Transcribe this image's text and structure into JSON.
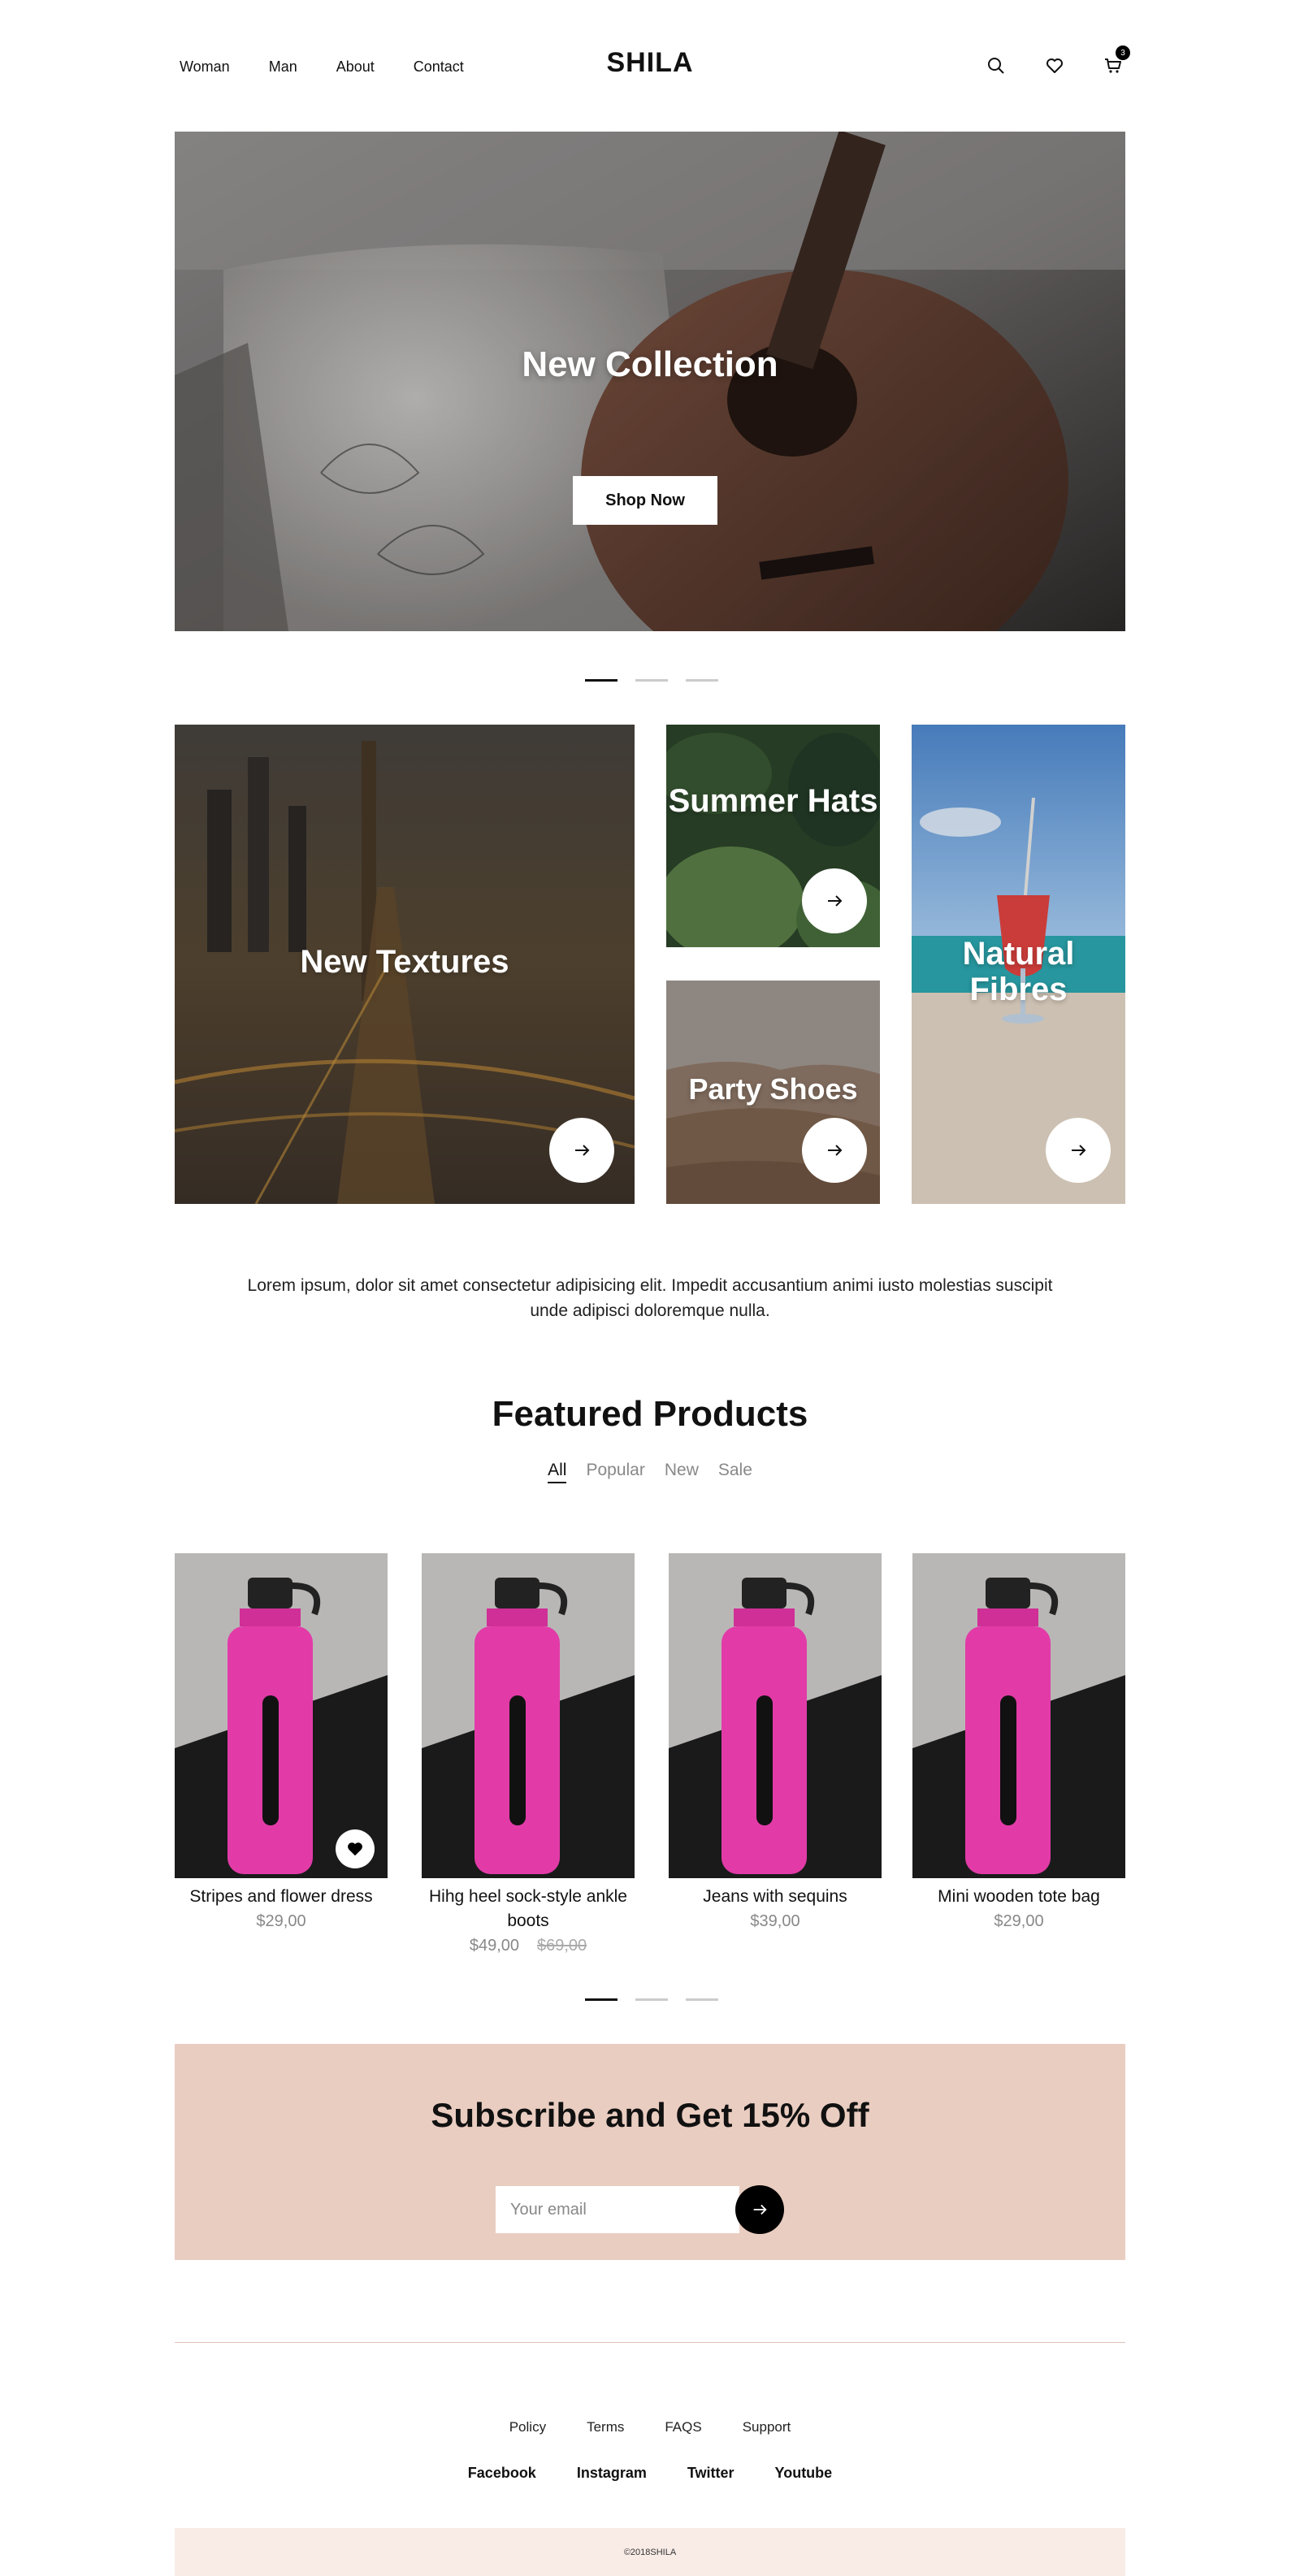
{
  "header": {
    "nav": [
      "Woman",
      "Man",
      "About",
      "Contact"
    ],
    "logo": "SHILA",
    "cart_count": "3",
    "icons": [
      "search-icon",
      "heart-icon",
      "cart-icon"
    ]
  },
  "hero": {
    "title": "New Collection",
    "button": "Shop Now",
    "active_slide": 1,
    "slides": 3
  },
  "categories": [
    {
      "label": "New Textures"
    },
    {
      "label": "Summer Hats"
    },
    {
      "label": "Party Shoes"
    },
    {
      "label": "Natural Fibres"
    }
  ],
  "intro": "Lorem ipsum, dolor sit amet consectetur adipisicing elit. Impedit accusantium animi iusto molestias suscipit unde adipisci doloremque nulla.",
  "featured": {
    "title": "Featured Products",
    "filters": [
      "All",
      "Popular",
      "New",
      "Sale"
    ],
    "active_filter": "All",
    "products": [
      {
        "name": "Stripes and flower dress",
        "price": "$29,00",
        "old_price": ""
      },
      {
        "name": "Hihg heel sock-style ankle boots",
        "price": "$49,00",
        "old_price": "$69,00"
      },
      {
        "name": "Jeans with sequins",
        "price": "$39,00",
        "old_price": ""
      },
      {
        "name": "Mini wooden tote bag",
        "price": "$29,00",
        "old_price": ""
      }
    ]
  },
  "subscribe": {
    "title": "Subscribe and Get 15% Off",
    "placeholder": "Your email"
  },
  "footer": {
    "links": [
      "Policy",
      "Terms",
      "FAQS",
      "Support"
    ],
    "social": [
      "Facebook",
      "Instagram",
      "Twitter",
      "Youtube"
    ],
    "copyright": "©2018SHILA"
  },
  "colors": {
    "accent_pink": "#eacdc1",
    "footer_bg": "#f9ece7",
    "text": "#111111",
    "muted": "#888888"
  }
}
